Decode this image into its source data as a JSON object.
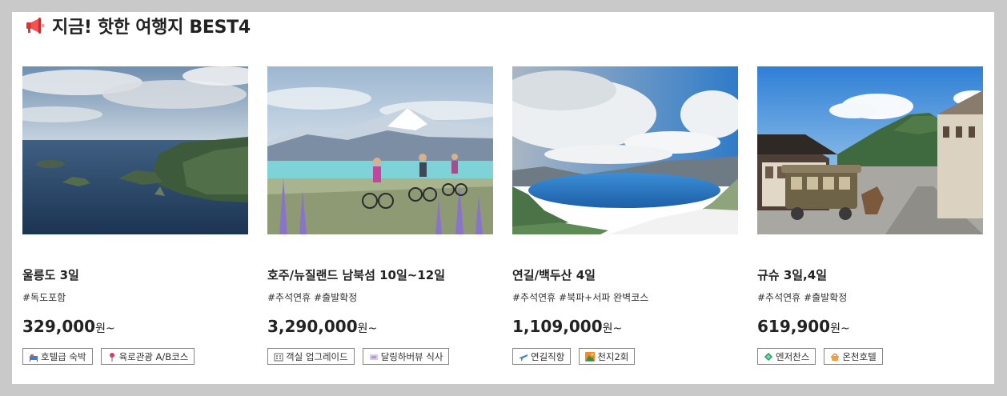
{
  "section": {
    "title": "지금! 핫한 여행지 BEST4",
    "icon": "megaphone-icon"
  },
  "cards": [
    {
      "name": "울릉도 3일",
      "tags": "#독도포함",
      "price": "329,000",
      "won": "원~",
      "photo": "ulleungdo-coast-photo",
      "chips": [
        {
          "label": "호텔급 숙박",
          "icon": "hotel-icon"
        },
        {
          "label": "육로관광 A/B코스",
          "icon": "pin-icon"
        }
      ]
    },
    {
      "name": "호주/뉴질랜드 남북섬 10일~12일",
      "tags": "#추석연휴 #출발확정",
      "price": "3,290,000",
      "won": "원~",
      "photo": "newzealand-cyclists-photo",
      "chips": [
        {
          "label": "객실 업그레이드",
          "icon": "room-icon"
        },
        {
          "label": "달링하버뷰 식사",
          "icon": "dining-icon"
        }
      ]
    },
    {
      "name": "연길/백두산 4일",
      "tags": "#추석연휴 #북파+서파 완벽코스",
      "price": "1,109,000",
      "won": "원~",
      "photo": "baekdusan-lake-photo",
      "chips": [
        {
          "label": "연길직항",
          "icon": "airplane-icon"
        },
        {
          "label": "천지2회",
          "icon": "mountain-icon"
        }
      ]
    },
    {
      "name": "규슈 3일,4일",
      "tags": "#추석연휴 #출발확정",
      "price": "619,900",
      "won": "원~",
      "photo": "kyushu-street-photo",
      "chips": [
        {
          "label": "엔저찬스",
          "icon": "diamond-icon"
        },
        {
          "label": "온천호텔",
          "icon": "basket-icon"
        }
      ]
    }
  ],
  "colors": {
    "background": "#c9c9c9",
    "panel": "#ffffff",
    "chip_border": "#888888",
    "megaphone": "#e03535"
  }
}
